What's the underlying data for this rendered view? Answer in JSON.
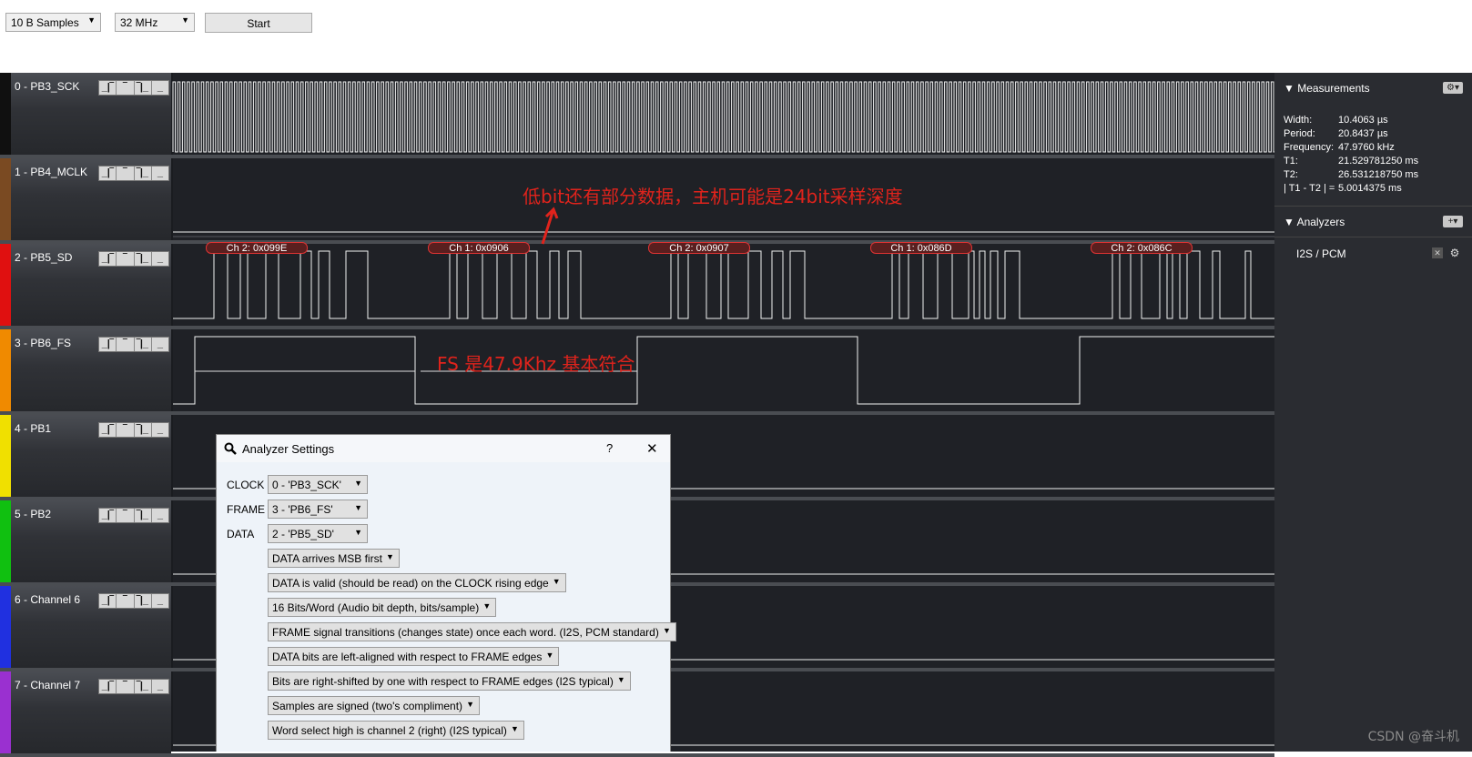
{
  "toolbar": {
    "samples_select": "10 B Samples",
    "rate_select": "32 MHz",
    "start_label": "Start"
  },
  "channels": [
    {
      "name": "0 - PB3_SCK",
      "color": "#101010"
    },
    {
      "name": "1 - PB4_MCLK",
      "color": "#7a4a22"
    },
    {
      "name": "2 - PB5_SD",
      "color": "#e01010"
    },
    {
      "name": "3 - PB6_FS",
      "color": "#f08a00"
    },
    {
      "name": "4 - PB1",
      "color": "#f0e000"
    },
    {
      "name": "5 - PB2",
      "color": "#10c010"
    },
    {
      "name": "6 - Channel 6",
      "color": "#2030e0"
    },
    {
      "name": "7 - Channel 7",
      "color": "#9a30d0"
    }
  ],
  "trigger_icons": [
    "rising-edge-icon",
    "high-level-icon",
    "falling-edge-icon",
    "low-level-icon"
  ],
  "decodes": [
    "Ch 2: 0x099E",
    "Ch 1: 0x0906",
    "Ch 2: 0x0907",
    "Ch 1: 0x086D",
    "Ch 2: 0x086C"
  ],
  "annotations": {
    "low_bit_note": "低bit还有部分数据，主机可能是24bit采样深度",
    "fs_note": "FS 是47.9Khz 基本符合"
  },
  "measurements": {
    "title": "Measurements",
    "rows": [
      {
        "k": "Width:",
        "v": "10.4063 µs"
      },
      {
        "k": "Period:",
        "v": "20.8437 µs"
      },
      {
        "k": "Frequency:",
        "v": "47.9760 kHz"
      },
      {
        "k": "T1:",
        "v": "21.529781250 ms"
      },
      {
        "k": "T2:",
        "v": "26.531218750 ms"
      },
      {
        "k": "| T1 - T2 | =",
        "v": "5.0014375 ms"
      }
    ]
  },
  "analyzers": {
    "title": "Analyzers",
    "item": "I2S / PCM"
  },
  "dialog": {
    "title": "Analyzer Settings",
    "help": "?",
    "close": "✕",
    "fields": [
      {
        "label": "CLOCK",
        "value": "0 - 'PB3_SCK'"
      },
      {
        "label": "FRAME",
        "value": "3 - 'PB6_FS'"
      },
      {
        "label": "DATA",
        "value": "2 - 'PB5_SD'"
      }
    ],
    "options": [
      "DATA arrives MSB first",
      "DATA is valid (should be read) on the CLOCK rising edge",
      "16 Bits/Word (Audio bit depth, bits/sample)",
      "FRAME signal transitions (changes state) once each word. (I2S, PCM standard)",
      "DATA bits are left-aligned with respect to FRAME edges",
      "Bits are right-shifted by one with respect to FRAME edges (I2S typical)",
      "Samples are signed (two's compliment)",
      "Word select high is channel 2 (right) (I2S typical)"
    ]
  },
  "watermark": "CSDN @奋斗机"
}
